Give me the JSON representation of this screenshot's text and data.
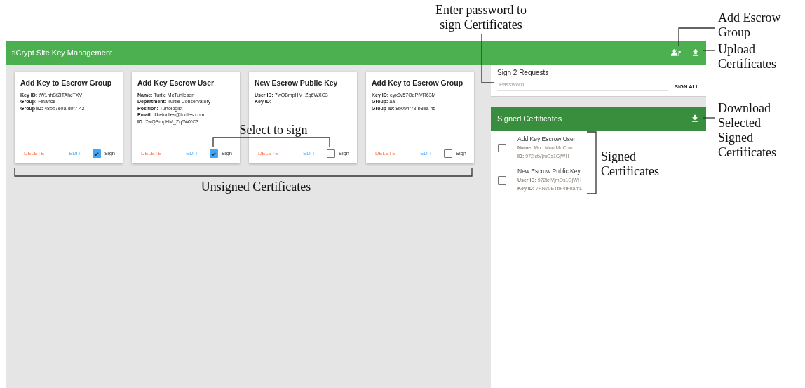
{
  "header": {
    "title": "tiCrypt Site Key Management"
  },
  "requests": [
    {
      "title": "Add Key to Escrow Group",
      "fields": [
        {
          "label": "Key ID:",
          "value": "tW1hhSf2ITAhcTXV"
        },
        {
          "label": "Group:",
          "value": "Finance"
        },
        {
          "label": "Group ID:",
          "value": "48bb7e0a-d0f7-42"
        }
      ],
      "delete": "DELETE",
      "edit": "EDIT",
      "sign": "Sign",
      "checked": true
    },
    {
      "title": "Add Key Escrow User",
      "fields": [
        {
          "label": "Name:",
          "value": "Turtle McTurtleson"
        },
        {
          "label": "Department:",
          "value": "Turtle Conservatory"
        },
        {
          "label": "Position:",
          "value": "Turtologist"
        },
        {
          "label": "Email:",
          "value": "iliketurtles@turtles.com"
        },
        {
          "label": "ID:",
          "value": "7wQBmpHM_Zq6WXC3"
        }
      ],
      "delete": "DELETE",
      "edit": "EDIT",
      "sign": "Sign",
      "checked": true
    },
    {
      "title": "New Escrow Public Key",
      "fields": [
        {
          "label": "User ID:",
          "value": "7wQBmpHM_Zq6WXC3"
        },
        {
          "label": "Key ID:"
        }
      ],
      "delete": "DELETE",
      "edit": "EDIT",
      "sign": "Sign",
      "checked": false
    },
    {
      "title": "Add Key to Escrow Group",
      "fields": [
        {
          "label": "Key ID:",
          "value": "eyx8v57OqPIVR63M"
        },
        {
          "label": "Group:",
          "value": "aa"
        },
        {
          "label": "Group ID:",
          "value": "8b094f78-b8ea-45"
        }
      ],
      "delete": "DELETE",
      "edit": "EDIT",
      "sign": "Sign",
      "checked": false
    }
  ],
  "sign_panel": {
    "title": "Sign 2 Requests",
    "password_placeholder": "Password",
    "button": "SIGN ALL"
  },
  "signed": {
    "title": "Signed Certificates",
    "items": [
      {
        "title": "Add Key Escrow User",
        "fields": [
          {
            "label": "Name:",
            "value": "Moo Moo Mr Cow"
          },
          {
            "label": "ID:",
            "value": "972ictVjmOs1GjWH"
          }
        ],
        "checked": false
      },
      {
        "title": "New Escrow Public Key",
        "fields": [
          {
            "label": "User ID:",
            "value": "972ictVjmOs1GjWH"
          },
          {
            "label": "Key ID:",
            "value": "7PN70ETbF4tFhamL"
          }
        ],
        "checked": false
      }
    ]
  },
  "annotations": [
    {
      "lines": [
        "Enter password to",
        "sign Certificates"
      ]
    },
    {
      "lines": [
        "Add Escrow",
        "Group"
      ]
    },
    {
      "lines": [
        "Upload",
        "Certificates"
      ]
    },
    {
      "lines": [
        "Download",
        "Selected",
        "Signed",
        "Certificates"
      ]
    },
    {
      "lines": [
        "Signed",
        "Certificates"
      ]
    },
    {
      "lines": [
        "Select to sign"
      ]
    },
    {
      "lines": [
        "Unsigned Certificates"
      ]
    }
  ]
}
